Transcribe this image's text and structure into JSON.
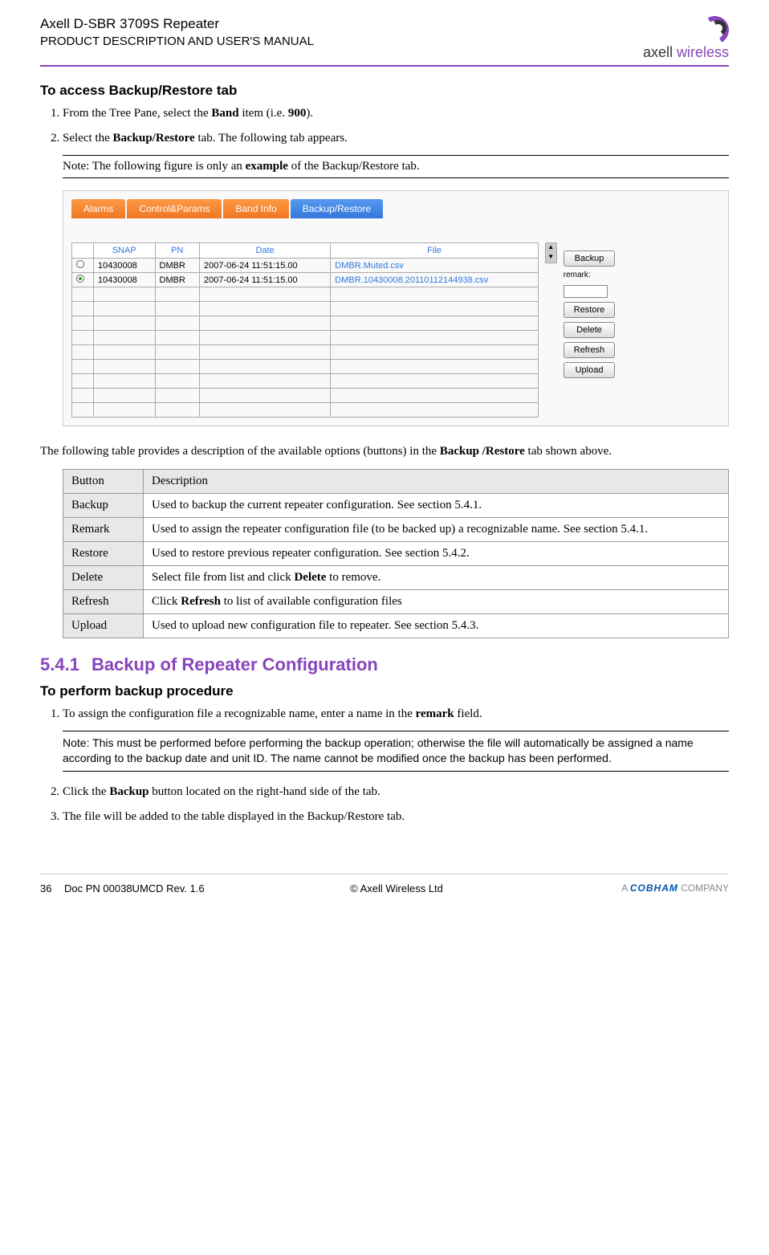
{
  "header": {
    "productName": "Axell D-SBR 3709S Repeater",
    "manualTitle": "PRODUCT DESCRIPTION AND USER'S MANUAL",
    "logoText1": "axell",
    "logoText2": "wireless"
  },
  "section1": {
    "heading": "To access Backup/Restore tab",
    "step1_pre": "From the Tree Pane, select the ",
    "step1_bold1": "Band",
    "step1_mid": " item (i.e. ",
    "step1_bold2": "900",
    "step1_post": ").",
    "step2_pre": "Select the ",
    "step2_bold": "Backup/Restore",
    "step2_post": " tab. The following tab appears.",
    "note_pre": "Note: The following figure is only an ",
    "note_bold": "example",
    "note_post": " of the Backup/Restore tab."
  },
  "tabs": {
    "t1": "Alarms",
    "t2": "Control&Params",
    "t3": "Band Info",
    "t4": "Backup/Restore"
  },
  "backupTable": {
    "headers": {
      "h1": "SNAP",
      "h2": "PN",
      "h3": "Date",
      "h4": "File"
    },
    "rows": [
      {
        "snap": "10430008",
        "pn": "DMBR",
        "date": "2007-06-24 11:51:15.00",
        "file": "DMBR.Muted.csv",
        "selected": false
      },
      {
        "snap": "10430008",
        "pn": "DMBR",
        "date": "2007-06-24 11:51:15.00",
        "file": "DMBR.10430008.20110112144938.csv",
        "selected": true
      }
    ]
  },
  "sideButtons": {
    "backup": "Backup",
    "remarkLabel": "remark:",
    "restore": "Restore",
    "delete": "Delete",
    "refresh": "Refresh",
    "upload": "Upload"
  },
  "descIntro": {
    "pre": "The following table provides a description of the available options (buttons) in the ",
    "bold": "Backup /Restore",
    "post": " tab shown above."
  },
  "descTable": {
    "header1": "Button",
    "header2": "Description",
    "rows": [
      {
        "btn": "Backup",
        "desc": "Used to backup the current repeater configuration. See section 5.4.1."
      },
      {
        "btn": "Remark",
        "desc": "Used to assign the repeater configuration file (to be backed up) a recognizable name. See section 5.4.1."
      },
      {
        "btn": "Restore",
        "desc": "Used to restore previous repeater configuration. See section 5.4.2."
      },
      {
        "btn": "Delete",
        "desc_pre": "Select file from list and click ",
        "desc_bold": "Delete",
        "desc_post": " to remove."
      },
      {
        "btn": "Refresh",
        "desc_pre": "Click ",
        "desc_bold": "Refresh",
        "desc_post": " to list of available configuration files"
      },
      {
        "btn": "Upload",
        "desc": "Used to upload new configuration file to repeater. See section 5.4.3."
      }
    ]
  },
  "section541": {
    "num": "5.4.1",
    "title": "Backup of Repeater Configuration",
    "subHeading": "To perform backup procedure",
    "step1_pre": "To assign the configuration file a recognizable name, enter a name in the ",
    "step1_bold": "remark",
    "step1_post": " field.",
    "note": "Note: This must be performed before performing the backup operation; otherwise the file will automatically be assigned a name according to the backup date and unit ID. The name cannot be modified once the backup has been performed.",
    "step2_pre": "Click the ",
    "step2_bold": "Backup",
    "step2_post": " button located on the right-hand side of the tab.",
    "step3": "The file will be added to the table displayed in the Backup/Restore tab."
  },
  "footer": {
    "page": "36",
    "docpn": "Doc PN 00038UMCD Rev. 1.6",
    "copyright": "© Axell Wireless Ltd",
    "companyPre": "A ",
    "companyBrand": "COBHAM",
    "companyPost": " COMPANY"
  }
}
